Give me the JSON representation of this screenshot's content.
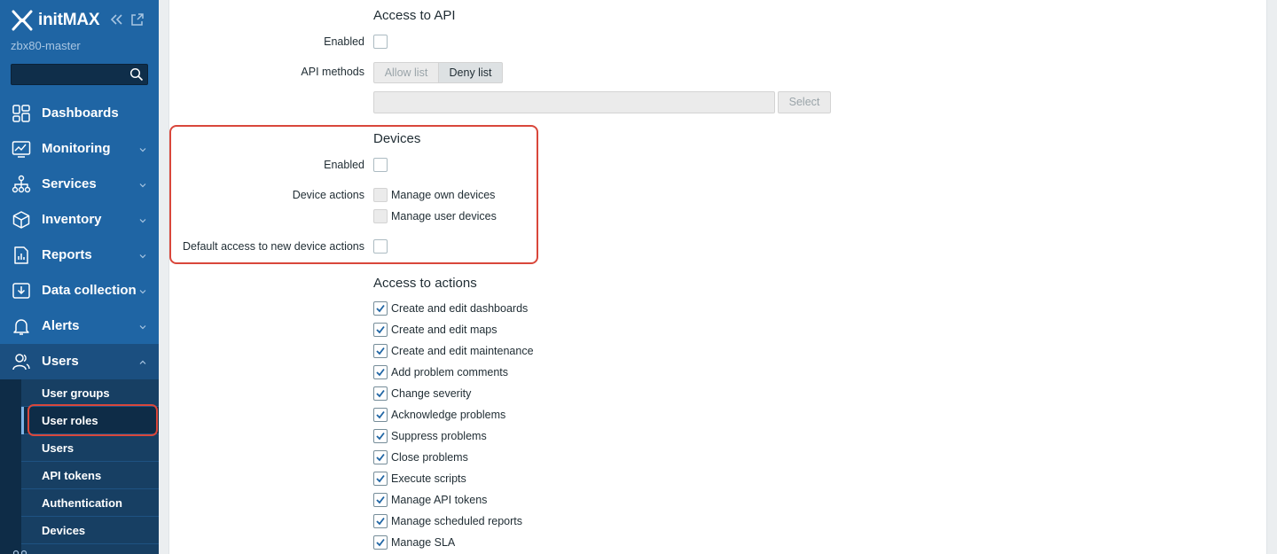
{
  "app": {
    "logo_text": "initMAX",
    "server_name": "zbx80-master",
    "search": {
      "value": "",
      "placeholder": ""
    }
  },
  "sidebar": {
    "menu": [
      {
        "label": "Dashboards",
        "icon": "dashboard-icon",
        "has_chevron": false
      },
      {
        "label": "Monitoring",
        "icon": "monitoring-icon",
        "has_chevron": true
      },
      {
        "label": "Services",
        "icon": "services-icon",
        "has_chevron": true
      },
      {
        "label": "Inventory",
        "icon": "inventory-icon",
        "has_chevron": true
      },
      {
        "label": "Reports",
        "icon": "reports-icon",
        "has_chevron": true
      },
      {
        "label": "Data collection",
        "icon": "data-collection-icon",
        "has_chevron": true
      },
      {
        "label": "Alerts",
        "icon": "alerts-icon",
        "has_chevron": true
      },
      {
        "label": "Users",
        "icon": "users-icon",
        "has_chevron": true,
        "expanded": true
      }
    ],
    "users_submenu": [
      {
        "label": "User groups",
        "selected": false
      },
      {
        "label": "User roles",
        "selected": true
      },
      {
        "label": "Users",
        "selected": false
      },
      {
        "label": "API tokens",
        "selected": false
      },
      {
        "label": "Authentication",
        "selected": false
      },
      {
        "label": "Devices",
        "selected": false
      }
    ]
  },
  "form": {
    "api_section": {
      "title": "Access to API",
      "enabled_label": "Enabled",
      "enabled": false,
      "methods_label": "API methods",
      "allow_list_label": "Allow list",
      "deny_list_label": "Deny list",
      "selected_mode": "Deny list",
      "select_button_label": "Select"
    },
    "devices_section": {
      "title": "Devices",
      "enabled_label": "Enabled",
      "enabled": false,
      "device_actions_label": "Device actions",
      "actions": [
        {
          "label": "Manage own devices",
          "checked": false,
          "disabled": true
        },
        {
          "label": "Manage user devices",
          "checked": false,
          "disabled": true
        }
      ],
      "default_access_label": "Default access to new device actions",
      "default_access": false
    },
    "actions_section": {
      "title": "Access to actions",
      "actions": [
        {
          "label": "Create and edit dashboards",
          "checked": true
        },
        {
          "label": "Create and edit maps",
          "checked": true
        },
        {
          "label": "Create and edit maintenance",
          "checked": true
        },
        {
          "label": "Add problem comments",
          "checked": true
        },
        {
          "label": "Change severity",
          "checked": true
        },
        {
          "label": "Acknowledge problems",
          "checked": true
        },
        {
          "label": "Suppress problems",
          "checked": true
        },
        {
          "label": "Close problems",
          "checked": true
        },
        {
          "label": "Execute scripts",
          "checked": true
        },
        {
          "label": "Manage API tokens",
          "checked": true
        },
        {
          "label": "Manage scheduled reports",
          "checked": true
        },
        {
          "label": "Manage SLA",
          "checked": true
        }
      ]
    }
  },
  "colors": {
    "sidebar_bg": "#1f65a4",
    "highlight_red": "#d9473b",
    "checkbox_tick": "#1f65a4"
  }
}
